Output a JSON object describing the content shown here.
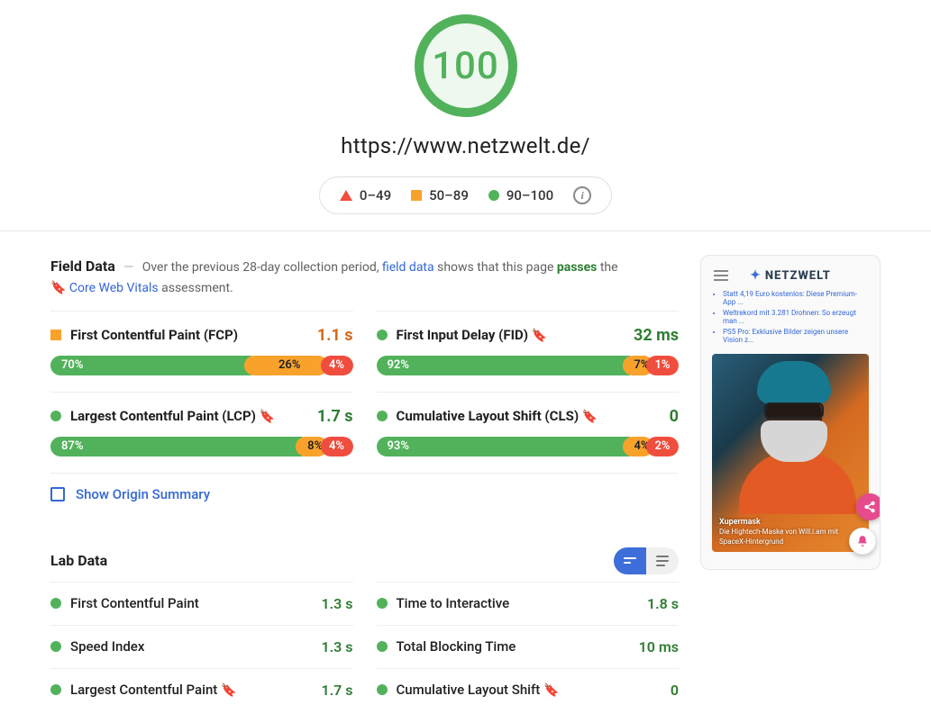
{
  "score": "100",
  "url": "https://www.netzwelt.de/",
  "legend": {
    "poor": "0–49",
    "mid": "50–89",
    "good": "90–100"
  },
  "field": {
    "heading": "Field Data",
    "intro_pre": "Over the previous 28-day collection period, ",
    "intro_link": "field data",
    "intro_mid": " shows that this page ",
    "intro_pass": "passes",
    "intro_post": " the ",
    "cwv": "Core Web Vitals",
    "intro_end": " assessment.",
    "metrics": [
      {
        "name": "First Contentful Paint (FCP)",
        "indicator": "orange",
        "value": "1.1 s",
        "value_class": "val-orange",
        "dist": {
          "good": "70%",
          "mid": "26%",
          "poor": "4%",
          "gw": 70,
          "mw": 26,
          "pw": 4,
          "mid_dark": true
        },
        "bookmark": false
      },
      {
        "name": "First Input Delay (FID)",
        "indicator": "green",
        "value": "32 ms",
        "value_class": "val-green",
        "dist": {
          "good": "92%",
          "mid": "7%",
          "poor": "1%",
          "gw": 92,
          "mw": 7,
          "pw": 1,
          "mid_dark": true
        },
        "bookmark": true
      },
      {
        "name": "Largest Contentful Paint (LCP)",
        "indicator": "green",
        "value": "1.7 s",
        "value_class": "val-green",
        "dist": {
          "good": "87%",
          "mid": "8%",
          "poor": "4%",
          "gw": 87,
          "mw": 8,
          "pw": 5,
          "mid_dark": true
        },
        "bookmark": true
      },
      {
        "name": "Cumulative Layout Shift (CLS)",
        "indicator": "green",
        "value": "0",
        "value_class": "val-green",
        "dist": {
          "good": "93%",
          "mid": "4%",
          "poor": "2%",
          "gw": 93,
          "mw": 4,
          "pw": 3,
          "mid_dark": true
        },
        "bookmark": true
      }
    ],
    "origin_link": "Show Origin Summary"
  },
  "lab": {
    "heading": "Lab Data",
    "items": [
      {
        "name": "First Contentful Paint",
        "value": "1.3 s",
        "bookmark": false
      },
      {
        "name": "Time to Interactive",
        "value": "1.8 s",
        "bookmark": false
      },
      {
        "name": "Speed Index",
        "value": "1.3 s",
        "bookmark": false
      },
      {
        "name": "Total Blocking Time",
        "value": "10 ms",
        "bookmark": false
      },
      {
        "name": "Largest Contentful Paint",
        "value": "1.7 s",
        "bookmark": true
      },
      {
        "name": "Cumulative Layout Shift",
        "value": "0",
        "bookmark": true
      }
    ]
  },
  "preview": {
    "brand": "NETZWELT",
    "links": [
      "Statt 4,19 Euro kostenlos: Diese Premium-App ...",
      "Weltrekord mit 3.281 Drohnen: So erzeugt man ...",
      "PS5 Pro: Exklusive Bilder zeigen unsere Vision z..."
    ],
    "caption_title": "Xupermask",
    "caption_sub1": "Die Hightech-Maske von Will.i.am mit",
    "caption_sub2": "SpaceX-Hintergrund"
  }
}
